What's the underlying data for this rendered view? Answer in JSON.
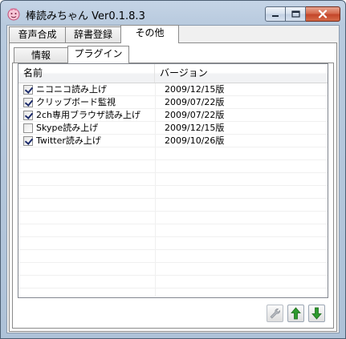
{
  "window": {
    "title": "棒読みちゃん Ver0.1.8.3"
  },
  "tabs": [
    {
      "label": "音声合成",
      "active": false
    },
    {
      "label": "辞書登録",
      "active": false
    },
    {
      "label": "その他",
      "active": true
    }
  ],
  "subtabs": [
    {
      "label": "情報",
      "active": false
    },
    {
      "label": "プラグイン",
      "active": true
    }
  ],
  "plugin_list": {
    "columns": [
      "名前",
      "バージョン"
    ],
    "rows": [
      {
        "name": "ニコニコ読み上げ",
        "version": "2009/12/15版",
        "checked": true
      },
      {
        "name": "クリップボード監視",
        "version": "2009/07/22版",
        "checked": true
      },
      {
        "name": "2ch専用ブラウザ読み上げ",
        "version": "2009/07/22版",
        "checked": true
      },
      {
        "name": "Skype読み上げ",
        "version": "2009/12/15版",
        "checked": false
      },
      {
        "name": "Twitter読み上げ",
        "version": "2009/10/26版",
        "checked": true
      }
    ]
  },
  "toolbar": {
    "settings_icon": "wrench-icon",
    "move_up_icon": "arrow-up-icon",
    "move_down_icon": "arrow-down-icon"
  },
  "colors": {
    "titlebar": "#b8cade",
    "close_button": "#c4462a",
    "arrow_green": "#2e9a2e"
  }
}
